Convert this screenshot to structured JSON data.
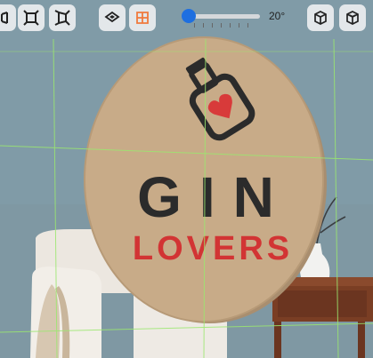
{
  "toolbar": {
    "left_buttons": [
      {
        "icon": "perspective-left-icon"
      },
      {
        "icon": "perspective-frame-icon"
      },
      {
        "icon": "perspective-squeeze-icon"
      }
    ],
    "center_buttons": [
      {
        "icon": "flat-plane-icon"
      },
      {
        "icon": "grid-surface-icon",
        "active_color": "#f07a3c"
      }
    ],
    "rotation": {
      "label": "20°",
      "value": 0
    },
    "right_buttons": [
      {
        "icon": "cube-outline-icon"
      },
      {
        "icon": "cube-rotate-icon"
      }
    ]
  },
  "canvas": {
    "sign": {
      "line1": "GIN",
      "line2": "LOVERS",
      "line1_color": "#2b2b2b",
      "line2_color": "#d23434",
      "board_color": "#c8ab88"
    },
    "guide_color": "#9be86f"
  }
}
